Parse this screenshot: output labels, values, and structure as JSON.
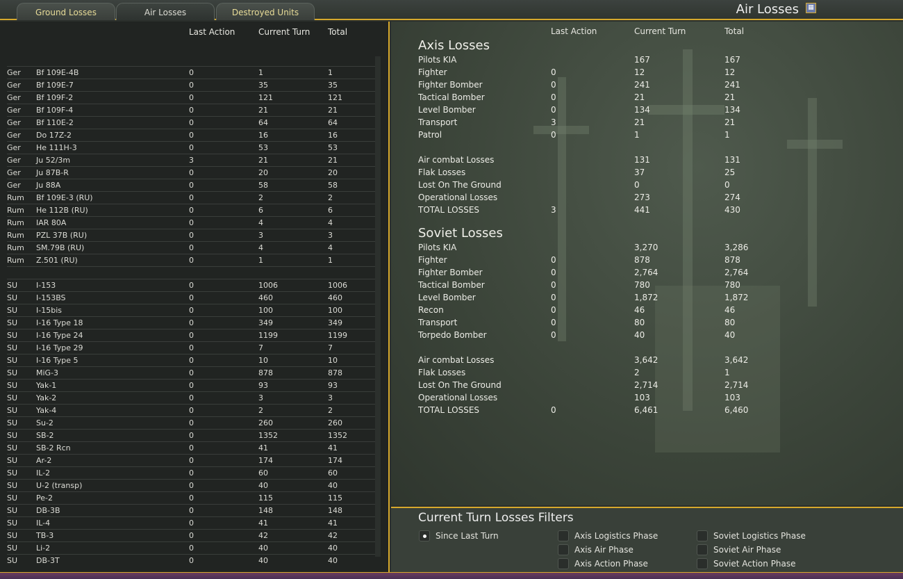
{
  "tabs": [
    "Ground Losses",
    "Air Losses",
    "Destroyed Units"
  ],
  "title": "Air Losses",
  "left": {
    "headers": {
      "last": "Last Action",
      "current": "Current Turn",
      "total": "Total"
    },
    "rows": [
      [
        "Ger",
        "Bf 109E-4B",
        "0",
        "1",
        "1"
      ],
      [
        "Ger",
        "Bf 109E-7",
        "0",
        "35",
        "35"
      ],
      [
        "Ger",
        "Bf 109F-2",
        "0",
        "121",
        "121"
      ],
      [
        "Ger",
        "Bf 109F-4",
        "0",
        "21",
        "21"
      ],
      [
        "Ger",
        "Bf 110E-2",
        "0",
        "64",
        "64"
      ],
      [
        "Ger",
        "Do 17Z-2",
        "0",
        "16",
        "16"
      ],
      [
        "Ger",
        "He 111H-3",
        "0",
        "53",
        "53"
      ],
      [
        "Ger",
        "Ju 52/3m",
        "3",
        "21",
        "21"
      ],
      [
        "Ger",
        "Ju 87B-R",
        "0",
        "20",
        "20"
      ],
      [
        "Ger",
        "Ju 88A",
        "0",
        "58",
        "58"
      ],
      [
        "Rum",
        "Bf 109E-3 (RU)",
        "0",
        "2",
        "2"
      ],
      [
        "Rum",
        "He 112B (RU)",
        "0",
        "6",
        "6"
      ],
      [
        "Rum",
        "IAR 80A",
        "0",
        "4",
        "4"
      ],
      [
        "Rum",
        "PZL 37B (RU)",
        "0",
        "3",
        "3"
      ],
      [
        "Rum",
        "SM.79B (RU)",
        "0",
        "4",
        "4"
      ],
      [
        "Rum",
        "Z.501 (RU)",
        "0",
        "1",
        "1"
      ],
      [
        "",
        "",
        "",
        "",
        ""
      ],
      [
        "SU",
        "I-153",
        "0",
        "1006",
        "1006"
      ],
      [
        "SU",
        "I-153BS",
        "0",
        "460",
        "460"
      ],
      [
        "SU",
        "I-15bis",
        "0",
        "100",
        "100"
      ],
      [
        "SU",
        "I-16 Type 18",
        "0",
        "349",
        "349"
      ],
      [
        "SU",
        "I-16 Type 24",
        "0",
        "1199",
        "1199"
      ],
      [
        "SU",
        "I-16 Type 29",
        "0",
        "7",
        "7"
      ],
      [
        "SU",
        "I-16 Type 5",
        "0",
        "10",
        "10"
      ],
      [
        "SU",
        "MiG-3",
        "0",
        "878",
        "878"
      ],
      [
        "SU",
        "Yak-1",
        "0",
        "93",
        "93"
      ],
      [
        "SU",
        "Yak-2",
        "0",
        "3",
        "3"
      ],
      [
        "SU",
        "Yak-4",
        "0",
        "2",
        "2"
      ],
      [
        "SU",
        "Su-2",
        "0",
        "260",
        "260"
      ],
      [
        "SU",
        "SB-2",
        "0",
        "1352",
        "1352"
      ],
      [
        "SU",
        "SB-2 Rcn",
        "0",
        "41",
        "41"
      ],
      [
        "SU",
        "Ar-2",
        "0",
        "174",
        "174"
      ],
      [
        "SU",
        "IL-2",
        "0",
        "60",
        "60"
      ],
      [
        "SU",
        "U-2 (transp)",
        "0",
        "40",
        "40"
      ],
      [
        "SU",
        "Pe-2",
        "0",
        "115",
        "115"
      ],
      [
        "SU",
        "DB-3B",
        "0",
        "148",
        "148"
      ],
      [
        "SU",
        "IL-4",
        "0",
        "41",
        "41"
      ],
      [
        "SU",
        "TB-3",
        "0",
        "42",
        "42"
      ],
      [
        "SU",
        "Li-2",
        "0",
        "40",
        "40"
      ],
      [
        "SU",
        "DB-3T",
        "0",
        "40",
        "40"
      ]
    ]
  },
  "right": {
    "headers": {
      "last": "Last Action",
      "current": "Current Turn",
      "total": "Total"
    },
    "axis": {
      "title": "Axis Losses",
      "rows": [
        [
          "Pilots KIA",
          "",
          "167",
          "167"
        ],
        [
          "Fighter",
          "0",
          "12",
          "12"
        ],
        [
          "Fighter Bomber",
          "0",
          "241",
          "241"
        ],
        [
          "Tactical Bomber",
          "0",
          "21",
          "21"
        ],
        [
          "Level Bomber",
          "0",
          "134",
          "134"
        ],
        [
          "Transport",
          "3",
          "21",
          "21"
        ],
        [
          "Patrol",
          "0",
          "1",
          "1"
        ],
        null,
        [
          "Air combat Losses",
          "",
          "131",
          "131"
        ],
        [
          "Flak Losses",
          "",
          "37",
          "25"
        ],
        [
          "Lost On The Ground",
          "",
          "0",
          "0"
        ],
        [
          "Operational Losses",
          "",
          "273",
          "274"
        ],
        [
          "TOTAL LOSSES",
          "3",
          "441",
          "430"
        ]
      ]
    },
    "soviet": {
      "title": "Soviet Losses",
      "rows": [
        [
          "Pilots KIA",
          "",
          "3,270",
          "3,286"
        ],
        [
          "Fighter",
          "0",
          "878",
          "878"
        ],
        [
          "Fighter Bomber",
          "0",
          "2,764",
          "2,764"
        ],
        [
          "Tactical Bomber",
          "0",
          "780",
          "780"
        ],
        [
          "Level Bomber",
          "0",
          "1,872",
          "1,872"
        ],
        [
          "Recon",
          "0",
          "46",
          "46"
        ],
        [
          "Transport",
          "0",
          "80",
          "80"
        ],
        [
          "Torpedo Bomber",
          "0",
          "40",
          "40"
        ],
        null,
        [
          "Air combat Losses",
          "",
          "3,642",
          "3,642"
        ],
        [
          "Flak Losses",
          "",
          "2",
          "1"
        ],
        [
          "Lost On The Ground",
          "",
          "2,714",
          "2,714"
        ],
        [
          "Operational Losses",
          "",
          "103",
          "103"
        ],
        [
          "TOTAL LOSSES",
          "0",
          "6,461",
          "6,460"
        ]
      ]
    }
  },
  "filters": {
    "title": "Current Turn Losses Filters",
    "options": [
      {
        "label": "Since Last Turn",
        "selected": true
      },
      {
        "label": "Axis Logistics Phase",
        "selected": false
      },
      {
        "label": "Axis Air Phase",
        "selected": false
      },
      {
        "label": "Axis Action Phase",
        "selected": false
      },
      {
        "label": "Soviet Logistics Phase",
        "selected": false
      },
      {
        "label": "Soviet Air Phase",
        "selected": false
      },
      {
        "label": "Soviet Action Phase",
        "selected": false
      }
    ]
  }
}
